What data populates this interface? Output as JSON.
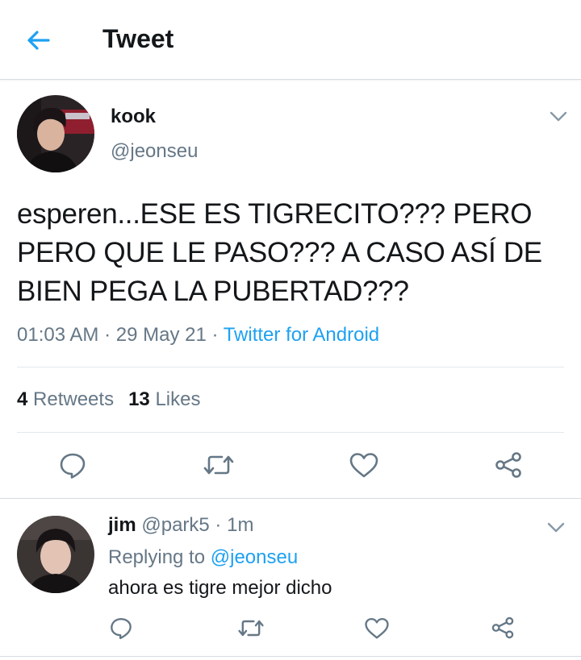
{
  "header": {
    "title": "Tweet",
    "back_icon": "arrow-left-icon",
    "accent": "#1da1f2"
  },
  "tweet": {
    "author_name": "kook",
    "author_handle": "@jeonseu",
    "text": "esperen...ESE ES TIGRECITO??? PERO PERO QUE LE PASO??? A CASO ASÍ DE BIEN PEGA LA PUBERTAD???",
    "time": "01:03 AM",
    "sep1": " · ",
    "date": "29 May 21",
    "sep2": " · ",
    "source": "Twitter for Android",
    "retweets_count": "4",
    "retweets_label": " Retweets",
    "likes_count": "13",
    "likes_label": " Likes",
    "actions": [
      "reply-icon",
      "retweet-icon",
      "like-icon",
      "share-icon"
    ]
  },
  "reply": {
    "author_name": "jim",
    "author_handle": "@park5",
    "sep": " · ",
    "time": "1m",
    "replying_prefix": "Replying to ",
    "replying_to": "@jeonseu",
    "text": "ahora es tigre mejor dicho",
    "actions": [
      "reply-icon",
      "retweet-icon",
      "like-icon",
      "share-icon"
    ]
  },
  "colors": {
    "text": "#14171a",
    "secondary": "#657786",
    "link": "#1da1f2",
    "divider": "#e1e8ed"
  }
}
